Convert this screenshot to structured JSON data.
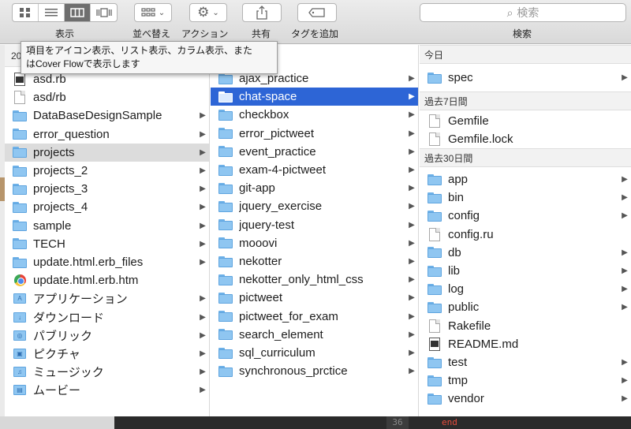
{
  "toolbar": {
    "view_label": "表示",
    "arrange_label": "並べ替え",
    "action_label": "アクション",
    "share_label": "共有",
    "tags_label": "タグを追加",
    "search_placeholder": "検索",
    "search_label": "検索"
  },
  "tooltip": {
    "line1": "項目をアイコン表示、リスト表示、カラム表示、また",
    "line2": "はCover Flowで表示します"
  },
  "col1": {
    "header": "20",
    "items": [
      {
        "name": "asd.rb",
        "icon": "ruby-file",
        "arrow": false
      },
      {
        "name": "asd/rb",
        "icon": "document",
        "arrow": false
      },
      {
        "name": "DataBaseDesignSample",
        "icon": "folder",
        "arrow": true
      },
      {
        "name": "error_question",
        "icon": "folder",
        "arrow": true
      },
      {
        "name": "projects",
        "icon": "folder",
        "arrow": true,
        "selected": true
      },
      {
        "name": "projects_2",
        "icon": "folder",
        "arrow": true
      },
      {
        "name": "projects_3",
        "icon": "folder",
        "arrow": true
      },
      {
        "name": "projects_4",
        "icon": "folder",
        "arrow": true
      },
      {
        "name": "sample",
        "icon": "folder",
        "arrow": true
      },
      {
        "name": "TECH",
        "icon": "folder",
        "arrow": true
      },
      {
        "name": "update.html.erb_files",
        "icon": "folder",
        "arrow": true
      },
      {
        "name": "update.html.erb.htm",
        "icon": "chrome",
        "arrow": false
      },
      {
        "name": "アプリケーション",
        "icon": "apps-folder",
        "arrow": true
      },
      {
        "name": "ダウンロード",
        "icon": "downloads-folder",
        "arrow": true
      },
      {
        "name": "パブリック",
        "icon": "public-folder",
        "arrow": true
      },
      {
        "name": "ピクチャ",
        "icon": "pictures-folder",
        "arrow": true
      },
      {
        "name": "ミュージック",
        "icon": "music-folder",
        "arrow": true
      },
      {
        "name": "ムービー",
        "icon": "movies-folder",
        "arrow": true
      }
    ]
  },
  "col2": {
    "items": [
      {
        "name": "ajax_practice"
      },
      {
        "name": "chat-space",
        "selected": true
      },
      {
        "name": "checkbox"
      },
      {
        "name": "error_pictweet"
      },
      {
        "name": "event_practice"
      },
      {
        "name": "exam-4-pictweet"
      },
      {
        "name": "git-app"
      },
      {
        "name": "jquery_exercise"
      },
      {
        "name": "jquery-test"
      },
      {
        "name": "mooovi"
      },
      {
        "name": "nekotter"
      },
      {
        "name": "nekotter_only_html_css"
      },
      {
        "name": "pictweet"
      },
      {
        "name": "pictweet_for_exam"
      },
      {
        "name": "search_element"
      },
      {
        "name": "sql_curriculum"
      },
      {
        "name": "synchronous_prctice"
      }
    ]
  },
  "col3": {
    "section_today": "今日",
    "section_7days": "過去7日間",
    "section_30days": "過去30日間",
    "today_items": [
      {
        "name": "spec",
        "icon": "folder",
        "arrow": true
      }
    ],
    "week_items": [
      {
        "name": "Gemfile",
        "icon": "document",
        "arrow": false
      },
      {
        "name": "Gemfile.lock",
        "icon": "document",
        "arrow": false
      }
    ],
    "month_items": [
      {
        "name": "app",
        "icon": "folder",
        "arrow": true
      },
      {
        "name": "bin",
        "icon": "folder",
        "arrow": true
      },
      {
        "name": "config",
        "icon": "folder",
        "arrow": true
      },
      {
        "name": "config.ru",
        "icon": "document",
        "arrow": false
      },
      {
        "name": "db",
        "icon": "folder",
        "arrow": true
      },
      {
        "name": "lib",
        "icon": "folder",
        "arrow": true
      },
      {
        "name": "log",
        "icon": "folder",
        "arrow": true
      },
      {
        "name": "public",
        "icon": "folder",
        "arrow": true
      },
      {
        "name": "Rakefile",
        "icon": "document",
        "arrow": false
      },
      {
        "name": "README.md",
        "icon": "ruby-file",
        "arrow": false
      },
      {
        "name": "test",
        "icon": "folder",
        "arrow": true
      },
      {
        "name": "tmp",
        "icon": "folder",
        "arrow": true
      },
      {
        "name": "vendor",
        "icon": "folder",
        "arrow": true
      }
    ]
  },
  "terminal": {
    "line_number": "36",
    "code": "end"
  },
  "colors": {
    "selection_blue": "#2d65d6",
    "selection_gray": "#dcdcdc",
    "folder_blue": "#8fc6f1"
  }
}
